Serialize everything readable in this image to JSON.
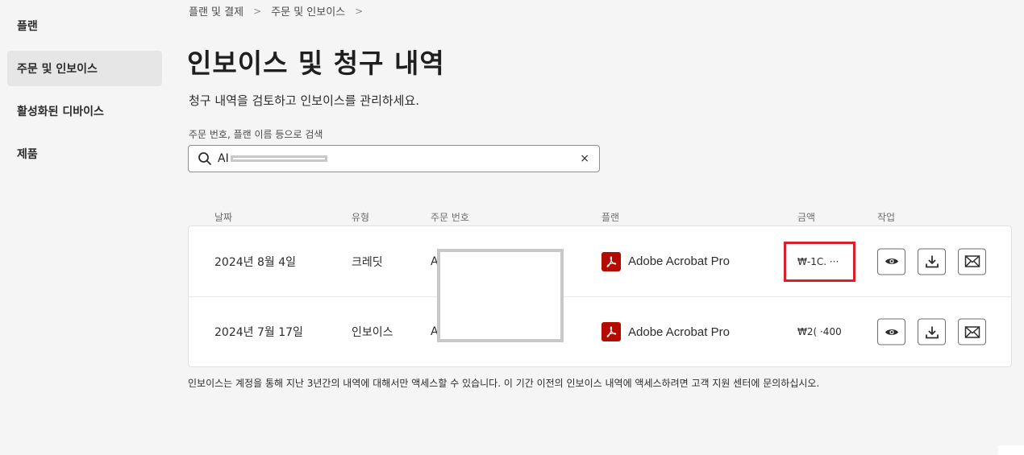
{
  "sidebar": {
    "items": [
      {
        "label": "플랜",
        "active": false
      },
      {
        "label": "주문 및 인보이스",
        "active": true
      },
      {
        "label": "활성화된 디바이스",
        "active": false
      },
      {
        "label": "제품",
        "active": false
      }
    ]
  },
  "breadcrumb": {
    "items": [
      "플랜 및 결제",
      "주문 및 인보이스"
    ],
    "separator": ">"
  },
  "page": {
    "title": "인보이스 및 청구 내역",
    "subtitle": "청구 내역을 검토하고 인보이스를 관리하세요."
  },
  "search": {
    "label": "주문 번호, 플랜 이름 등으로 검색",
    "value": "AI",
    "clear_symbol": "×"
  },
  "table": {
    "headers": {
      "date": "날짜",
      "type": "유형",
      "order": "주문 번호",
      "plan": "플랜",
      "amount": "금액",
      "actions": "작업"
    },
    "rows": [
      {
        "date": "2024년 8월 4일",
        "type": "크레딧",
        "order": "A",
        "plan": "Adobe Acrobat Pro",
        "amount": "₩-1C. ···"
      },
      {
        "date": "2024년 7월 17일",
        "type": "인보이스",
        "order": "A",
        "plan": "Adobe Acrobat Pro",
        "amount": "₩2( ·400"
      }
    ]
  },
  "footnote": "인보이스는 계정을 통해 지난 3년간의 내역에 대해서만 액세스할 수 있습니다. 이 기간 이전의 인보이스 내역에 액세스하려면 고객 지원 센터에 문의하십시오.",
  "colors": {
    "acrobat_red": "#b30b00",
    "highlight": "#d7202a",
    "redaction": "#c8c8c8"
  },
  "icons": [
    "search-icon",
    "clear-icon",
    "acrobat-icon",
    "eye-icon",
    "download-icon",
    "mail-icon"
  ]
}
